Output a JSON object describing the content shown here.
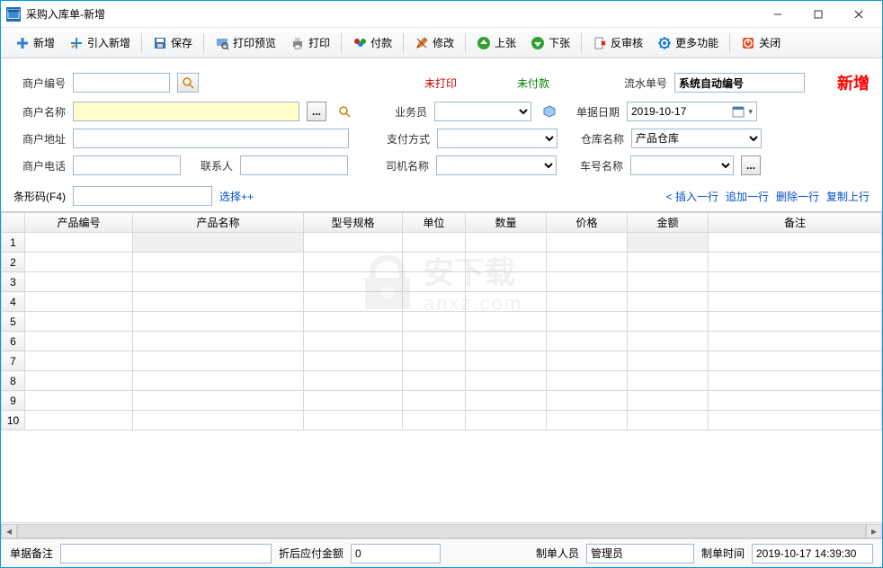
{
  "window": {
    "title": "采购入库单-新增"
  },
  "toolbar": {
    "new": "新增",
    "import_new": "引入新增",
    "save": "保存",
    "print_preview": "打印预览",
    "print": "打印",
    "pay": "付款",
    "modify": "修改",
    "prev": "上张",
    "next": "下张",
    "unapprove": "反审核",
    "more": "更多功能",
    "close": "关闭"
  },
  "form": {
    "merchant_no_label": "商户编号",
    "merchant_name_label": "商户名称",
    "merchant_addr_label": "商户地址",
    "merchant_tel_label": "商户电话",
    "contact_label": "联系人",
    "unprinted": "未打印",
    "unpaid": "未付款",
    "salesman_label": "业务员",
    "pay_method_label": "支付方式",
    "driver_label": "司机名称",
    "serial_label": "流水单号",
    "serial_value": "系统自动编号",
    "doc_date_label": "单据日期",
    "doc_date_value": "2019-10-17",
    "warehouse_label": "仓库名称",
    "warehouse_value": "产品仓库",
    "car_label": "车号名称",
    "status_new": "新增"
  },
  "barcode": {
    "label": "条形码(F4)",
    "select": "选择++",
    "insert_row": "< 插入一行",
    "append_row": "追加一行",
    "delete_row": "删除一行",
    "copy_row": "复制上行"
  },
  "grid": {
    "headers": [
      "产品编号",
      "产品名称",
      "型号规格",
      "单位",
      "数量",
      "价格",
      "金额",
      "备注"
    ],
    "row_count": 10
  },
  "footer": {
    "remark_label": "单据备注",
    "discount_label": "折后应付金额",
    "discount_value": "0",
    "creator_label": "制单人员",
    "creator_value": "管理员",
    "create_time_label": "制单时间",
    "create_time_value": "2019-10-17 14:39:30"
  },
  "watermark": {
    "line1": "安下载",
    "line2": "anxz.com"
  }
}
